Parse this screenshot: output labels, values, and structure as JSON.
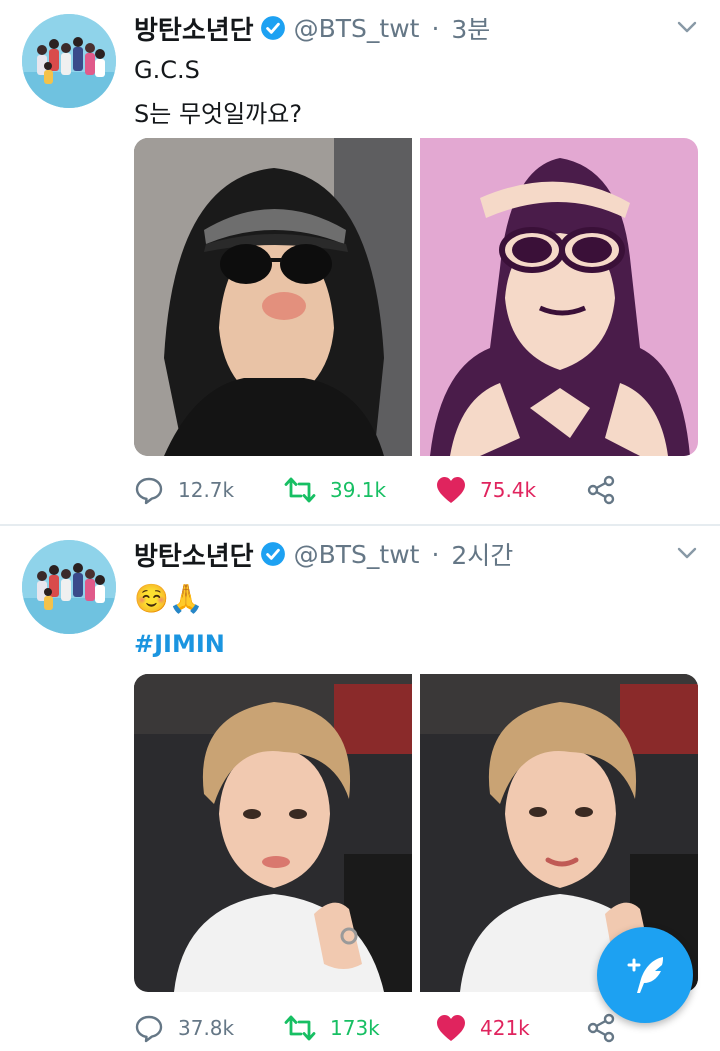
{
  "tweets": [
    {
      "author_name": "방탄소년단",
      "handle": "@BTS_twt",
      "separator": "·",
      "time": "3분",
      "lines": [
        "G.C.S",
        "S는 무엇일까요?"
      ],
      "stats": {
        "replies": "12.7k",
        "retweets": "39.1k",
        "likes": "75.4k"
      },
      "liked": true,
      "media": [
        "photo-person-black-hoodie-sunglasses",
        "pop-art-illustration-pink"
      ]
    },
    {
      "author_name": "방탄소년단",
      "handle": "@BTS_twt",
      "separator": "·",
      "time": "2시간",
      "emoji": "☺️🙏",
      "hashtag": "#JIMIN",
      "stats": {
        "replies": "37.8k",
        "retweets": "173k",
        "likes": "421k"
      },
      "liked": true,
      "media": [
        "selfie-photo-1",
        "selfie-photo-2"
      ]
    }
  ],
  "icons": {
    "verified": "verified-badge-icon",
    "reply": "reply-icon",
    "retweet": "retweet-icon",
    "like": "heart-icon",
    "share": "share-icon",
    "more": "chevron-down-icon",
    "compose": "compose-tweet-icon"
  },
  "colors": {
    "brand_blue": "#1da1f2",
    "retweet_green": "#17bf63",
    "like_red": "#e0245e",
    "secondary_text": "#657786",
    "hashtag_blue": "#1b95e0"
  }
}
